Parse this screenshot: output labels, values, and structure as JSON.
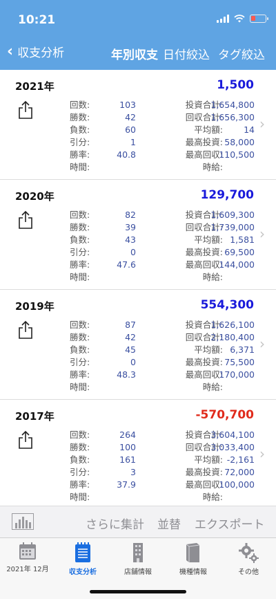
{
  "status": {
    "time": "10:21"
  },
  "nav": {
    "back_label": "収支分析",
    "current": "年別収支",
    "date_filter": "日付絞込",
    "tag_filter": "タグ絞込"
  },
  "labels": {
    "left": [
      "回数:",
      "勝数:",
      "負数:",
      "引分:",
      "勝率:",
      "時間:"
    ],
    "right": [
      "投資合計:",
      "回収合計:",
      "平均額:",
      "最高投資:",
      "最高回収:",
      "時給:"
    ]
  },
  "years": [
    {
      "year": "2021年",
      "amount": "1,500",
      "sign": "pos",
      "left": [
        "103",
        "42",
        "60",
        "1",
        "40.8",
        ""
      ],
      "right": [
        "1,654,800",
        "1,656,300",
        "14",
        "58,000",
        "110,500",
        ""
      ]
    },
    {
      "year": "2020年",
      "amount": "129,700",
      "sign": "pos",
      "left": [
        "82",
        "39",
        "43",
        "0",
        "47.6",
        ""
      ],
      "right": [
        "1,609,300",
        "1,739,000",
        "1,581",
        "69,500",
        "144,000",
        ""
      ]
    },
    {
      "year": "2019年",
      "amount": "554,300",
      "sign": "pos",
      "left": [
        "87",
        "42",
        "45",
        "0",
        "48.3",
        ""
      ],
      "right": [
        "1,626,100",
        "2,180,400",
        "6,371",
        "75,500",
        "170,000",
        ""
      ]
    },
    {
      "year": "2017年",
      "amount": "-570,700",
      "sign": "neg",
      "left": [
        "264",
        "100",
        "161",
        "3",
        "37.9",
        ""
      ],
      "right": [
        "3,604,100",
        "3,033,400",
        "-2,161",
        "72,000",
        "100,000",
        ""
      ]
    }
  ],
  "toolbar": {
    "aggregate": "さらに集計",
    "sort": "並替",
    "export": "エクスポート"
  },
  "tabs": [
    {
      "label": "2021年 12月",
      "icon": "calendar-icon"
    },
    {
      "label": "収支分析",
      "icon": "notebook-icon",
      "active": true
    },
    {
      "label": "店舗情報",
      "icon": "building-icon"
    },
    {
      "label": "機種情報",
      "icon": "book-icon"
    },
    {
      "label": "その他",
      "icon": "gear-icon"
    }
  ],
  "colors": {
    "header": "#5fa4e3",
    "positive": "#1a1adb",
    "negative": "#e02b1c",
    "tab_active": "#1a6ee0"
  }
}
